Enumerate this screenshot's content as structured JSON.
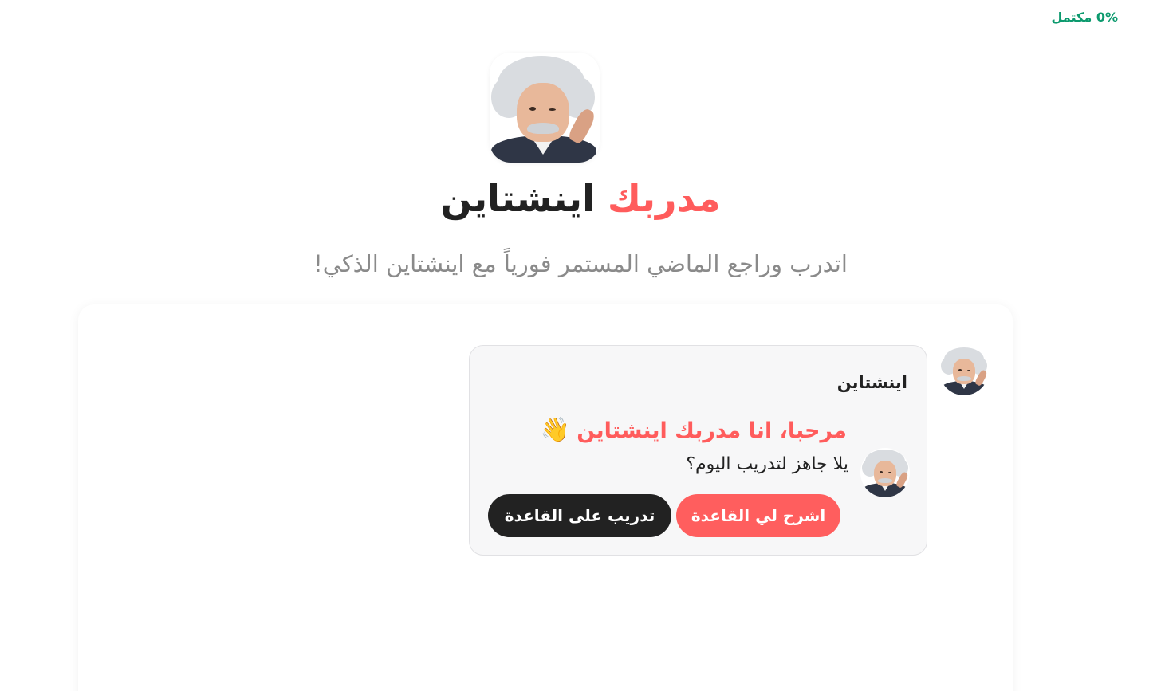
{
  "progress": {
    "label": "0% مكتمل"
  },
  "header": {
    "title_accent": "مدربك",
    "title_main": "اينشتاين",
    "subtitle": "اتدرب وراجع الماضي المستمر فورياً مع اينشتاين الذكي!"
  },
  "chat": {
    "message": {
      "sender": "اينشتاين",
      "greeting": "مرحبا، انا مدربك اينشتاين",
      "greeting_icon": "waving-hand-icon",
      "question": "يلا جاهز لتدريب اليوم؟",
      "buttons": {
        "explain_label": "اشرح لي القاعدة",
        "train_label": "تدريب على القاعدة"
      }
    }
  },
  "colors": {
    "accent": "#ff5c5c",
    "dark": "#222222",
    "progress": "#0c9a6e",
    "muted": "#8a8a8a"
  }
}
